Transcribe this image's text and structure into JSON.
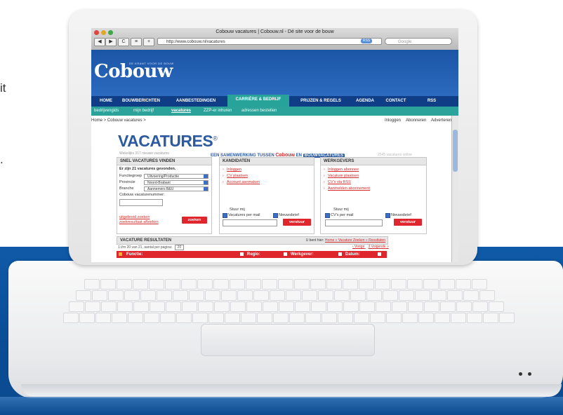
{
  "page": {
    "left_fragments": [
      "it",
      "."
    ]
  },
  "browser": {
    "window_title": "Cobouw vacatures | Cobouw.nl - Dé site voor de bouw",
    "url": "http://www.cobouw.nl/vacatures",
    "rss_badge": "RSS",
    "search_placeholder": "Google",
    "buttons": [
      "◀",
      "▶",
      "C",
      "≡",
      "+"
    ]
  },
  "site": {
    "logo": "Cobouw",
    "tagline": "DE KRANT VOOR DE BOUW",
    "main_nav": [
      {
        "label": "HOME"
      },
      {
        "label": "BOUWBERICHTEN"
      },
      {
        "label": "AANBESTEDINGEN"
      },
      {
        "label": "CARRIÈRE & BEDRIJF"
      },
      {
        "label": "PRIJZEN & REGELS"
      },
      {
        "label": "AGENDA"
      },
      {
        "label": "CONTACT"
      },
      {
        "label": "RSS"
      }
    ],
    "sub_nav": [
      {
        "label": "bedrijvengids"
      },
      {
        "label": "mijn bedrijf"
      },
      {
        "label": "vacatures"
      },
      {
        "label": "ZZP-er inhuren"
      },
      {
        "label": "adressen bestellen"
      }
    ],
    "breadcrumb": "Home > Cobouw vacatures >",
    "account_links": [
      "Inloggen",
      "Abonneren",
      "Adverteren"
    ]
  },
  "vacatures": {
    "logo": "VACATURES",
    "registered_mark": "®",
    "subline": "Wekelijks 317 nieuwe vacatures",
    "partner_prefix": "EEN SAMENWERKING TUSSEN",
    "partner_cobouw": "Cobouw",
    "partner_and": "EN",
    "partner_bv": "BOUWVACATURES",
    "faded_right": "2545 vacatures online"
  },
  "panels": {
    "search": {
      "title": "SNEL VACATURES VINDEN",
      "found": "Er zijn 21 vacatures gevonden.",
      "functiegroep_label": "Functiegroep",
      "functiegroep_value": "Uitvoering/Productie",
      "provincie_label": "Provincie",
      "provincie_value": "Noord-Brabant",
      "branche_label": "Branche",
      "branche_value": "Aannemers B&U",
      "nummer_label": "Cobouw vacaturenummer:",
      "link_extended": "uitgebreid zoeken",
      "link_clear": "zoekresultaat afbreken",
      "button": "zoeken"
    },
    "kandidaten": {
      "title": "KANDIDATEN",
      "links": [
        "Inloggen",
        "CV plaatsen",
        "Account aanmaken"
      ],
      "stuur_label": "Stuur mij",
      "check1": "Vacatures per mail",
      "check2": "Nieuwsbrief",
      "button": "verstuur"
    },
    "werkgevers": {
      "title": "WERKGEVERS",
      "links": [
        "Inloggen abonnee",
        "Vacature plaatsen",
        "CV's via RSS",
        "Aanmelden abonnement"
      ],
      "stuur_label": "Stuur mij",
      "check1": "CV's per mail",
      "check2": "Nieuwsbrief",
      "button": "verstuur"
    }
  },
  "results": {
    "title": "VACATURE RESULTATEN",
    "you_are_here": "U bent hier:",
    "trail": "Home » Vacature Zoeken » Resultaten",
    "range": "1 t/m 20 van 21, aantal per pagina:",
    "per_page": "20",
    "prev": "‹ Vorige",
    "next": "2 Volgende »",
    "columns": [
      "Functie:",
      "Regio:",
      "Werkgever:",
      "Datum:"
    ]
  }
}
